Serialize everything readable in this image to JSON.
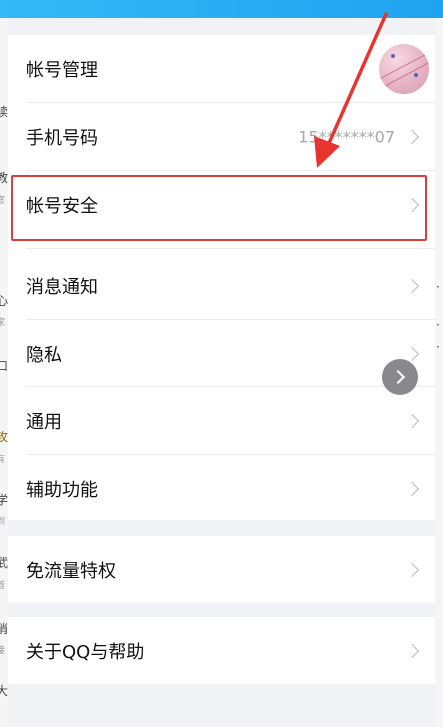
{
  "settings": {
    "items": [
      {
        "label": "帐号管理"
      },
      {
        "label": "手机号码",
        "value": "15*******07"
      },
      {
        "label": "帐号安全"
      },
      {
        "label": "消息通知"
      },
      {
        "label": "隐私"
      },
      {
        "label": "通用"
      },
      {
        "label": "辅助功能"
      },
      {
        "label": "免流量特权"
      },
      {
        "label": "关于QQ与帮助"
      }
    ]
  },
  "background_fragments": {
    "left": [
      "读",
      "教",
      "官",
      "心",
      "家",
      "口",
      "攻",
      "有",
      "学",
      "到",
      "武",
      "首",
      "消",
      "接",
      "大"
    ],
    "right": [
      "·",
      "·",
      "·"
    ]
  },
  "icons": {
    "chevron": "chevron-right-icon",
    "avatar": "avatar-image",
    "floating": "floating-chevron-icon"
  },
  "colors": {
    "highlight": "#e23b3b",
    "arrow": "#e8342f",
    "topbar": "#1fa3f0"
  }
}
